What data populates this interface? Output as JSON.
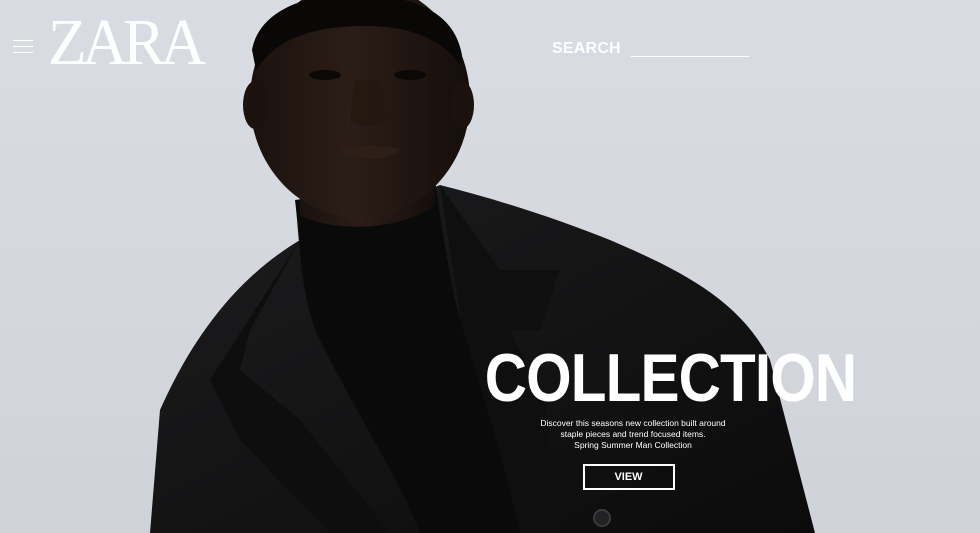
{
  "header": {
    "menu_icon": "hamburger-menu-icon",
    "logo_text": "ZARA",
    "search_label": "SEARCH",
    "search_value": ""
  },
  "hero": {
    "image_subject": "model in black turtleneck and black suit jacket",
    "background_color": "#d7dbe1"
  },
  "promo": {
    "title": "COLLECTION",
    "description_lines": [
      "Discover this seasons new collection built around",
      "staple pieces and trend focused items.",
      "Spring Summer Man Collection"
    ],
    "button_label": "VIEW"
  },
  "colors": {
    "text": "#ffffff",
    "garment": "#161616"
  }
}
